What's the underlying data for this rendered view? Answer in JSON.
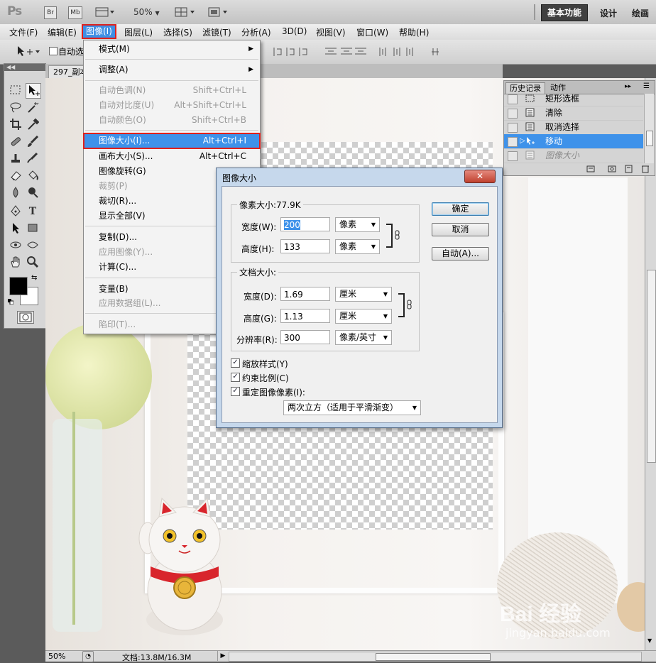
{
  "app": {
    "logo": "Ps",
    "btn_br": "Br",
    "btn_mb": "Mb",
    "zoom": "50%",
    "workspaces": [
      "基本功能",
      "设计",
      "绘画"
    ]
  },
  "menubar": [
    "文件(F)",
    "编辑(E)",
    "图像(I)",
    "图层(L)",
    "选择(S)",
    "滤镜(T)",
    "分析(A)",
    "3D(D)",
    "视图(V)",
    "窗口(W)",
    "帮助(H)"
  ],
  "options": {
    "auto_select": "自动选"
  },
  "document": {
    "tab": "297_副本"
  },
  "image_menu": {
    "mode": "模式(M)",
    "adjust": "调整(A)",
    "auto_tone": "自动色调(N)",
    "auto_tone_sc": "Shift+Ctrl+L",
    "auto_contrast": "自动对比度(U)",
    "auto_contrast_sc": "Alt+Shift+Ctrl+L",
    "auto_color": "自动颜色(O)",
    "auto_color_sc": "Shift+Ctrl+B",
    "image_size": "图像大小(I)...",
    "image_size_sc": "Alt+Ctrl+I",
    "canvas_size": "画布大小(S)...",
    "canvas_size_sc": "Alt+Ctrl+C",
    "rotate": "图像旋转(G)",
    "crop": "裁剪(P)",
    "trim": "裁切(R)...",
    "reveal_all": "显示全部(V)",
    "duplicate": "复制(D)...",
    "apply_image": "应用图像(Y)...",
    "calculations": "计算(C)...",
    "variables": "变量(B)",
    "apply_data": "应用数据组(L)...",
    "trap": "陷印(T)..."
  },
  "history": {
    "tabs": [
      "历史记录",
      "动作"
    ],
    "items": [
      "矩形选框",
      "清除",
      "取消选择",
      "移动",
      "图像大小"
    ]
  },
  "dialog": {
    "title": "图像大小",
    "pixel_dims": "像素大小:77.9K",
    "width_label": "宽度(W):",
    "width_val": "200",
    "width_unit": "像素",
    "height_label": "高度(H):",
    "height_val": "133",
    "height_unit": "像素",
    "doc_size": "文档大小:",
    "doc_width_label": "宽度(D):",
    "doc_width_val": "1.69",
    "doc_width_unit": "厘米",
    "doc_height_label": "高度(G):",
    "doc_height_val": "1.13",
    "doc_height_unit": "厘米",
    "res_label": "分辨率(R):",
    "res_val": "300",
    "res_unit": "像素/英寸",
    "scale_styles": "缩放样式(Y)",
    "constrain": "约束比例(C)",
    "resample": "重定图像像素(I):",
    "method": "两次立方（适用于平滑渐变）",
    "ok": "确定",
    "cancel": "取消",
    "auto": "自动(A)..."
  },
  "status": {
    "zoom": "50%",
    "doc": "文档:13.8M/16.3M"
  },
  "watermark": {
    "brand": "Bai 经验",
    "url": "jingyan.baidu.com"
  },
  "colors": {
    "highlight": "#3e92ea",
    "redbox": "#e0201c"
  }
}
